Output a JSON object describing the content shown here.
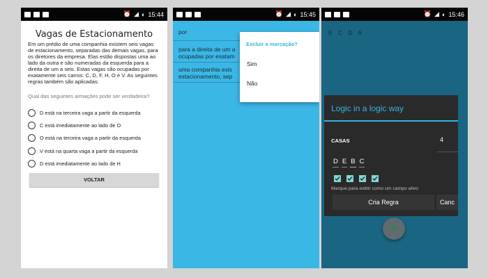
{
  "screens": [
    {
      "status_time": "15:44",
      "title": "Vagas de Estacionamento",
      "description": "Em um prédio de uma companhia existem seis vagas de estacionamento, separadas das demais vagas, para os diretores da empresa. Elas estão dispostas uma ao lado da outra e são numeradas da esquerda para a direita de um a seis. Estas vagas são ocupadas por exatamente seis carros: C, D, F, H, O e V. As seguintes regras também são aplicadas:",
      "question": "Qual das seguintes armações pode ser verdadeira?",
      "options": [
        "D está na terceira vaga a partir da esquerda",
        "C está imediatamente ao lado de O",
        "O está na terceira vaga a partir da esquerda",
        "V está na quarta vaga a partir da esquerda",
        "D está imediatamente ao lado de H"
      ],
      "button": "VOLTAR"
    },
    {
      "status_time": "15:45",
      "items": [
        "por",
        "para a direita de um a\nocupadas por exatam",
        "uma companhia exis\nestacionamento, sep"
      ],
      "popup_title": "Excluir a marcação?",
      "popup_yes": "Sim",
      "popup_no": "Não"
    },
    {
      "status_time": "15:46",
      "app_title": "E C D A",
      "dialog_title": "Logic in a logic way",
      "casas_label": "CASAS",
      "casas_value": "4",
      "letters": [
        "D",
        "E",
        "B",
        "C"
      ],
      "hint": "Marque para exibir como um campo ativo",
      "create_button": "Cria Regra",
      "cancel_button": "Canc",
      "fab_symbol": "+"
    }
  ],
  "colors": {
    "accent": "#33b5e5",
    "screen2_bg": "#3bb7e6",
    "screen3_bg": "#1a6581",
    "checkbox": "#7fd8d5"
  }
}
